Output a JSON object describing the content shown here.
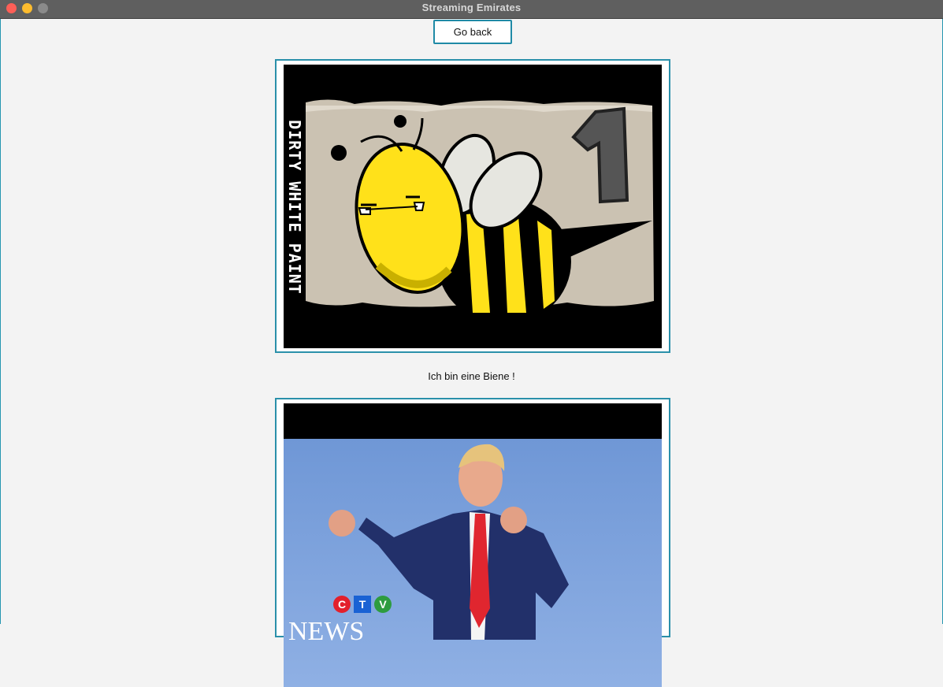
{
  "window": {
    "title": "Streaming Emirates"
  },
  "toolbar": {
    "go_back_label": "Go back"
  },
  "videos": [
    {
      "caption": "Ich bin eine Biene !",
      "thumbnail_text": "DIRTY WHITE PAINT",
      "thumbnail_number": "1"
    },
    {
      "caption": "",
      "logo_letters": [
        "C",
        "T",
        "V"
      ],
      "logo_word": "NEWS"
    }
  ]
}
